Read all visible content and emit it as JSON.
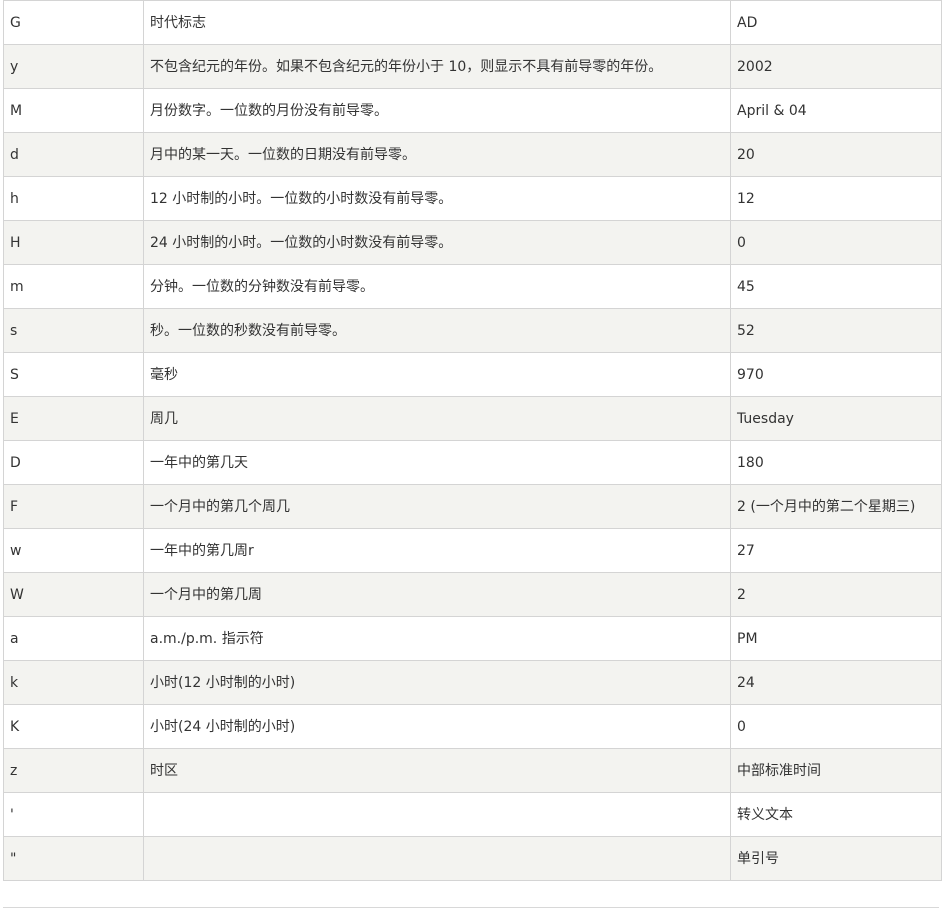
{
  "rows": [
    {
      "letter": "G",
      "description": "时代标志",
      "example": "AD"
    },
    {
      "letter": "y",
      "description": "不包含纪元的年份。如果不包含纪元的年份小于 10，则显示不具有前导零的年份。",
      "example": "2002"
    },
    {
      "letter": "M",
      "description": "月份数字。一位数的月份没有前导零。",
      "example": "April & 04"
    },
    {
      "letter": "d",
      "description": "月中的某一天。一位数的日期没有前导零。",
      "example": "20"
    },
    {
      "letter": "h",
      "description": "12 小时制的小时。一位数的小时数没有前导零。",
      "example": "12"
    },
    {
      "letter": "H",
      "description": "24 小时制的小时。一位数的小时数没有前导零。",
      "example": "0"
    },
    {
      "letter": "m",
      "description": "分钟。一位数的分钟数没有前导零。",
      "example": "45"
    },
    {
      "letter": "s",
      "description": "秒。一位数的秒数没有前导零。",
      "example": "52"
    },
    {
      "letter": "S",
      "description": "毫秒",
      "example": "970"
    },
    {
      "letter": "E",
      "description": "周几",
      "example": "Tuesday"
    },
    {
      "letter": "D",
      "description": "一年中的第几天",
      "example": "180"
    },
    {
      "letter": "F",
      "description": "一个月中的第几个周几",
      "example": "2 (一个月中的第二个星期三)"
    },
    {
      "letter": "w",
      "description": "一年中的第几周r",
      "example": "27"
    },
    {
      "letter": "W",
      "description": "一个月中的第几周",
      "example": "2"
    },
    {
      "letter": "a",
      "description": "a.m./p.m. 指示符",
      "example": "PM"
    },
    {
      "letter": "k",
      "description": "小时(12 小时制的小时)",
      "example": "24"
    },
    {
      "letter": "K",
      "description": "小时(24 小时制的小时)",
      "example": "0"
    },
    {
      "letter": "z",
      "description": "时区",
      "example": "中部标准时间"
    },
    {
      "letter": "'",
      "description": "",
      "example": "转义文本"
    },
    {
      "letter": "\"",
      "description": "",
      "example": "单引号"
    }
  ]
}
